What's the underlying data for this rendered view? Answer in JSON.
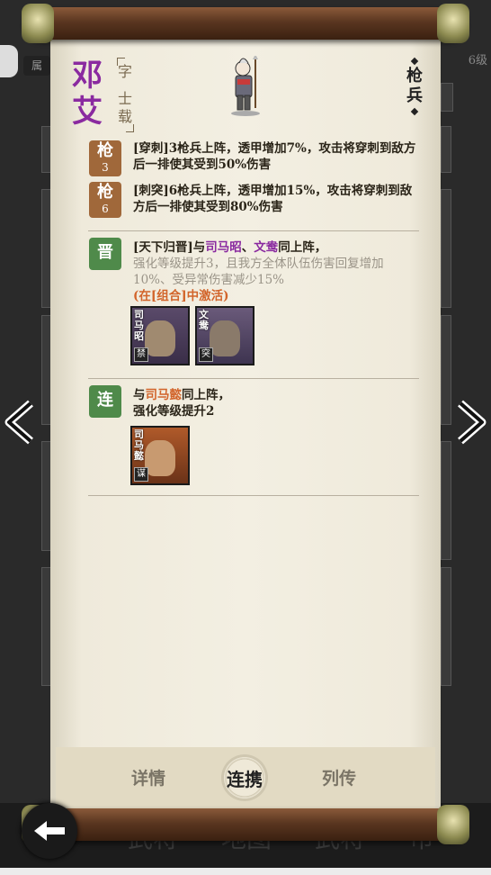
{
  "background": {
    "tag": "属",
    "level": "6级",
    "bottom_tabs": [
      "武",
      "武将",
      "地图",
      "武将",
      "市"
    ]
  },
  "general": {
    "name": "邓艾",
    "courtesy_label": "字",
    "courtesy_name": "士载",
    "unit_type": "枪兵"
  },
  "traits": [
    {
      "badge": "枪",
      "level": "3",
      "text": "[穿刺]3枪兵上阵，透甲增加7%，攻击将穿刺到敌方后一排使其受到50%伤害"
    },
    {
      "badge": "枪",
      "level": "6",
      "text": "[刺突]6枪兵上阵，透甲增加15%，攻击将穿刺到敌方后一排使其受到80%伤害"
    }
  ],
  "combo_jin": {
    "badge": "晋",
    "prefix": "[天下归晋]与",
    "partner1": "司马昭",
    "sep": "、",
    "partner2": "文鸯",
    "suffix": "同上阵，",
    "effect": "强化等级提升3，且我方全体队伍伤害回复增加10%、受异常伤害减少15%",
    "status": "(在[组合]中激活)",
    "portraits": [
      {
        "name": "司马昭",
        "tag": "禁"
      },
      {
        "name": "文鸯",
        "tag": "突"
      }
    ]
  },
  "combo_lian": {
    "badge": "连",
    "prefix": "与",
    "partner": "司马懿",
    "suffix": "同上阵，",
    "effect": "强化等级提升2",
    "portraits": [
      {
        "name": "司马懿",
        "tag": "谋"
      }
    ]
  },
  "tabs": {
    "details": "详情",
    "combo": "连携",
    "biography": "列传"
  },
  "colors": {
    "name_purple": "#8a2aa0",
    "highlight_orange": "#d2642a",
    "badge_brown": "#a0683a",
    "badge_green": "#4f8a4a"
  }
}
